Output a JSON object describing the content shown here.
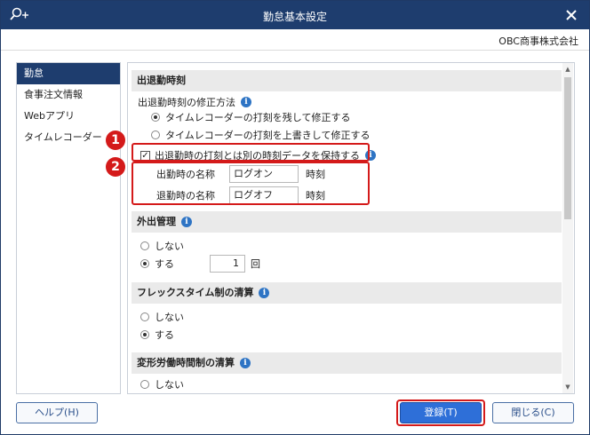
{
  "window": {
    "title": "勤怠基本設定",
    "company": "OBC商事株式会社"
  },
  "sidebar": {
    "items": [
      {
        "label": "勤怠"
      },
      {
        "label": "食事注文情報"
      },
      {
        "label": "Webアプリ"
      },
      {
        "label": "タイムレコーダー"
      }
    ]
  },
  "sec1": {
    "heading": "出退勤時刻",
    "method_label": "出退勤時刻の修正方法",
    "option_keep": "タイムレコーダーの打刻を残して修正する",
    "option_overwrite": "タイムレコーダーの打刻を上書きして修正する",
    "hold_label": "出退勤時の打刻とは別の時刻データを保持する",
    "start_name_label": "出勤時の名称",
    "start_name_value": "ログオン",
    "end_name_label": "退勤時の名称",
    "end_name_value": "ログオフ",
    "suffix": "時刻"
  },
  "sec2": {
    "heading": "外出管理",
    "opt_no": "しない",
    "opt_yes": "する",
    "count": "1",
    "unit": "回"
  },
  "sec3": {
    "heading": "フレックスタイム制の清算",
    "opt_no": "しない",
    "opt_yes": "する"
  },
  "sec4": {
    "heading": "変形労働時間制の清算",
    "opt_no": "しない"
  },
  "badges": {
    "one": "1",
    "two": "2"
  },
  "buttons": {
    "help": "ヘルプ(H)",
    "register": "登録(T)",
    "close": "閉じる(C)"
  },
  "icons": {
    "info": "i"
  }
}
